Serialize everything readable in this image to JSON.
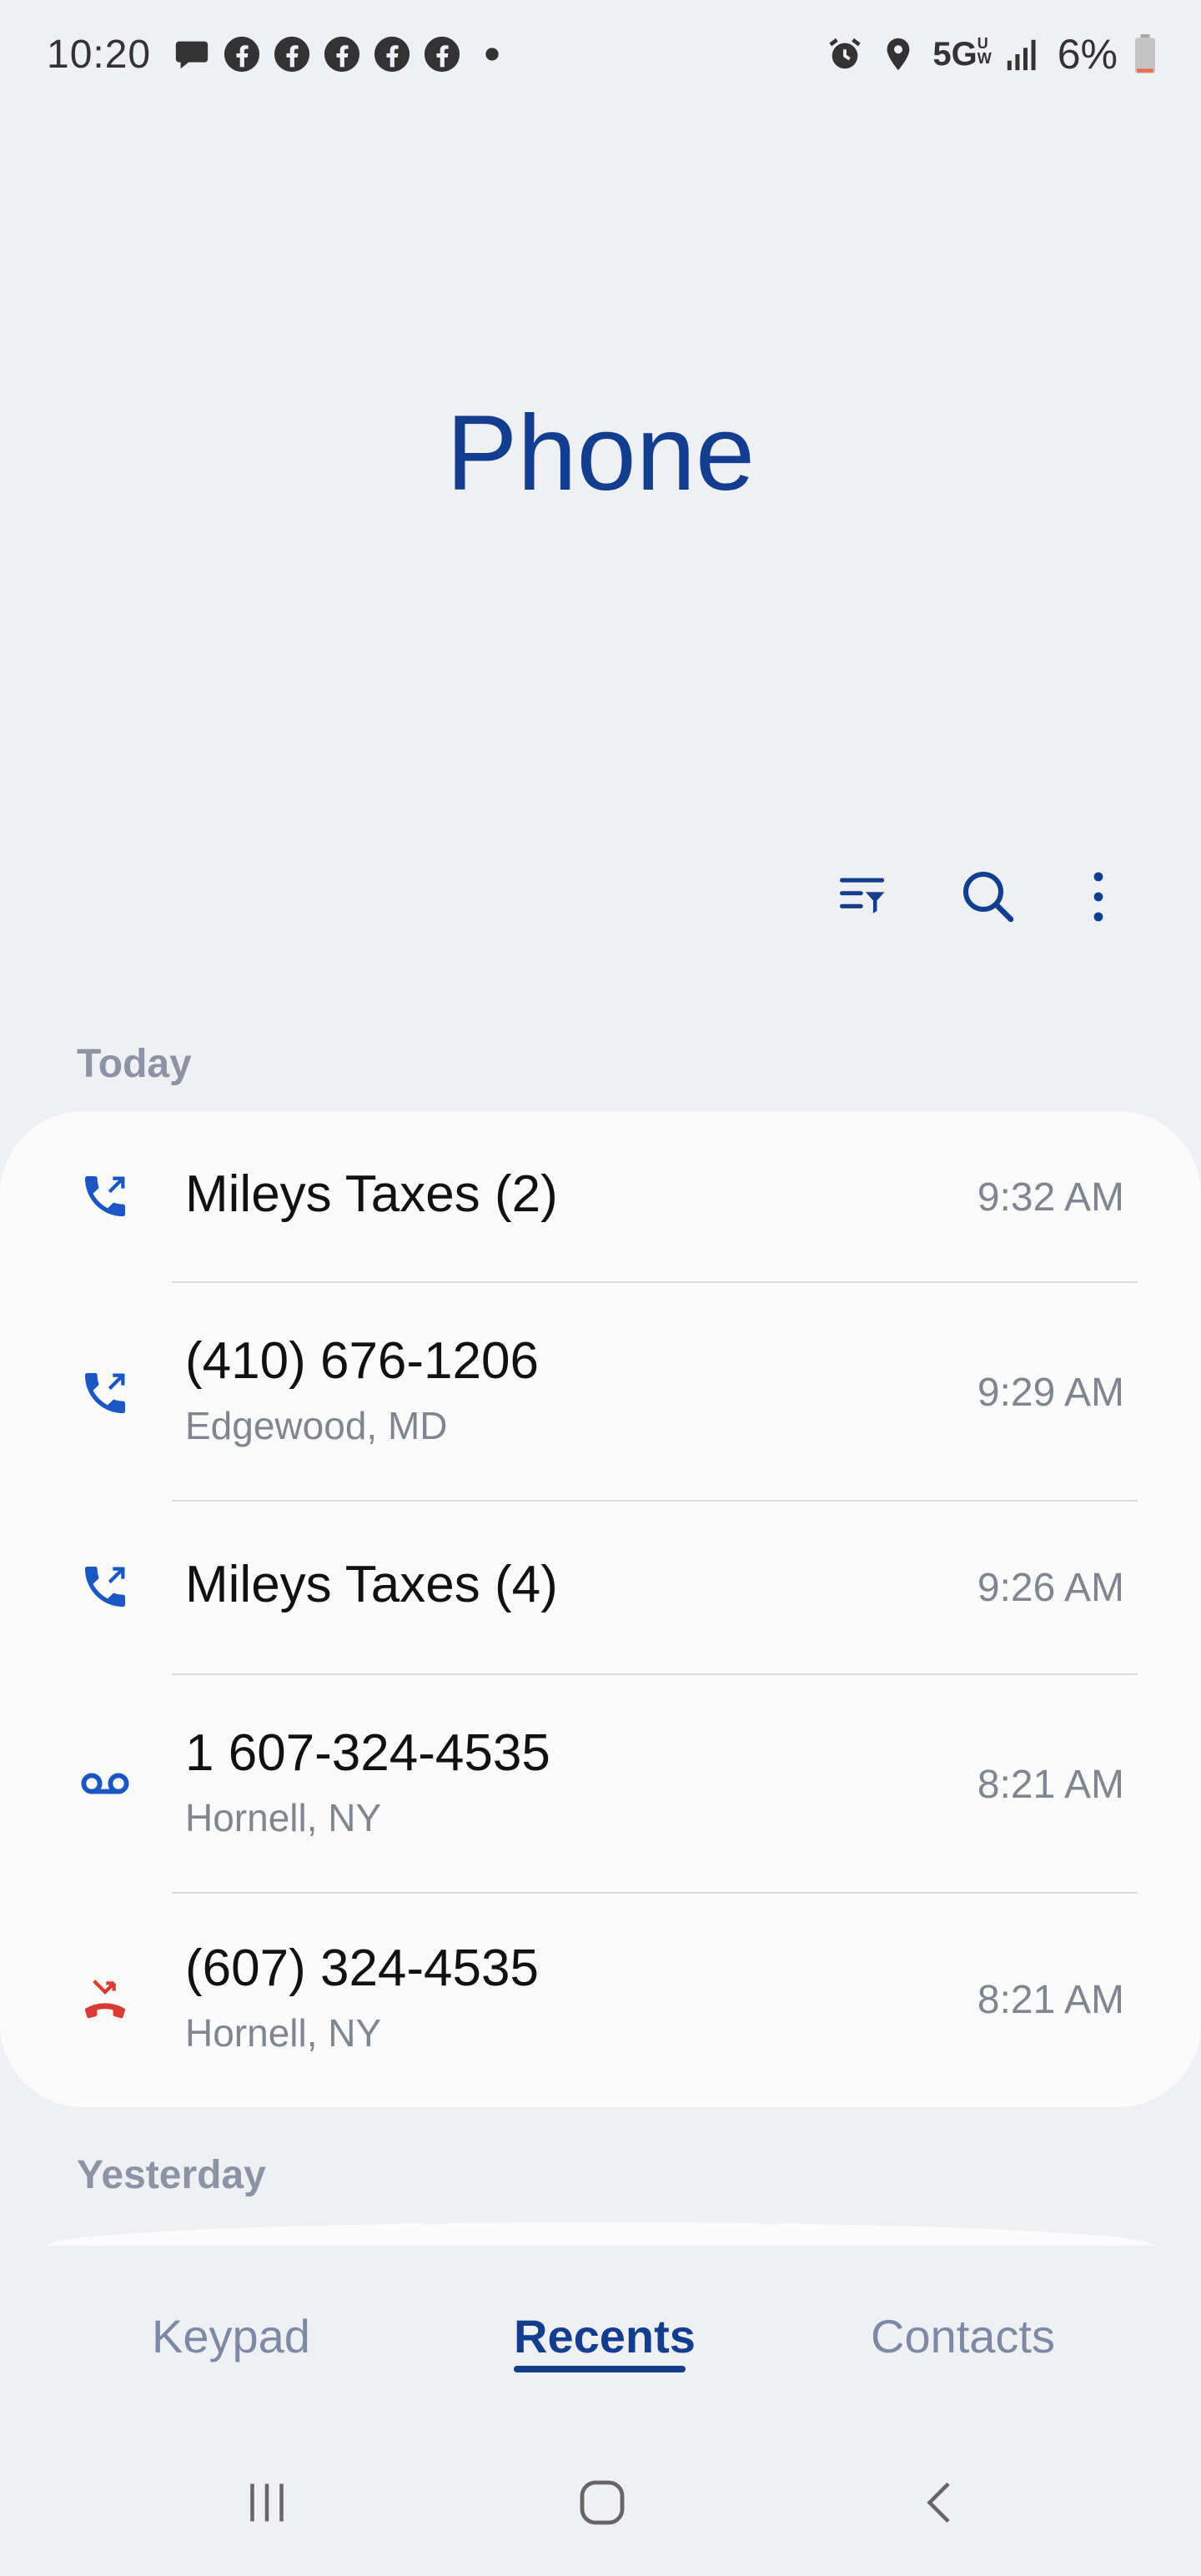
{
  "status_bar": {
    "time": "10:20",
    "network": "5G",
    "network_sub": "UW",
    "battery": "6%",
    "icons": [
      "chat-icon",
      "facebook-icon",
      "facebook-icon",
      "facebook-icon",
      "facebook-icon",
      "facebook-icon",
      "dot-icon",
      "alarm-icon",
      "location-icon",
      "signal-icon",
      "battery-icon"
    ]
  },
  "header": {
    "title": "Phone"
  },
  "toolbar": {
    "icons": [
      "filter-icon",
      "search-icon",
      "more-options-icon"
    ]
  },
  "sections": {
    "today": "Today",
    "yesterday": "Yesterday"
  },
  "calls": [
    {
      "name": "Mileys Taxes (2)",
      "sub": "",
      "time": "9:32 AM",
      "type": "outgoing",
      "icon": "outgoing-call-icon"
    },
    {
      "name": "(410) 676-1206",
      "sub": "Edgewood, MD",
      "time": "9:29 AM",
      "type": "outgoing",
      "icon": "outgoing-call-icon"
    },
    {
      "name": "Mileys Taxes (4)",
      "sub": "",
      "time": "9:26 AM",
      "type": "outgoing",
      "icon": "outgoing-call-icon"
    },
    {
      "name": "1 607-324-4535",
      "sub": "Hornell, NY",
      "time": "8:21 AM",
      "type": "voicemail",
      "icon": "voicemail-icon"
    },
    {
      "name": "(607) 324-4535",
      "sub": "Hornell, NY",
      "time": "8:21 AM",
      "type": "missed",
      "icon": "missed-call-icon"
    }
  ],
  "tabs": [
    {
      "label": "Keypad",
      "active": false
    },
    {
      "label": "Recents",
      "active": true
    },
    {
      "label": "Contacts",
      "active": false
    }
  ],
  "colors": {
    "accent": "#133d8e",
    "outgoing": "#1a56c4",
    "missed": "#d93a33",
    "background": "#eff0f4",
    "card": "#fbfbfb"
  }
}
